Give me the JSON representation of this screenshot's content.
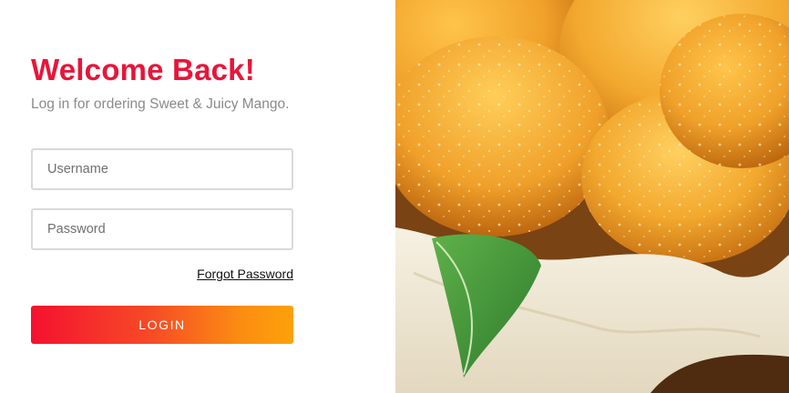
{
  "login": {
    "title": "Welcome Back!",
    "subtitle": "Log in for ordering Sweet & Juicy Mango.",
    "username_placeholder": "Username",
    "password_placeholder": "Password",
    "forgot_password_label": "Forgot Password",
    "login_button_label": "LOGIN"
  },
  "colors": {
    "title": "#e8153a",
    "button_gradient_start": "#f4112f",
    "button_gradient_end": "#fda10a"
  },
  "hero_image": {
    "icon": "mango-basket-photo"
  }
}
